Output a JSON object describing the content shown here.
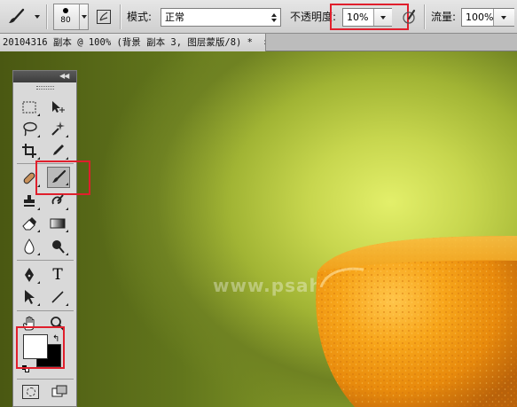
{
  "options_bar": {
    "brush_size": "80",
    "mode_label": "模式:",
    "mode_value": "正常",
    "opacity_label": "不透明度:",
    "opacity_value": "10%",
    "flow_label": "流量:",
    "flow_value": "100%"
  },
  "document": {
    "tab_title": "20104316 副本 @ 100% (背景 副本 3, 图层蒙版/8) *",
    "close_glyph": "×"
  },
  "toolbox": {
    "type_tool_glyph": "T",
    "active_tool": "brush",
    "foreground_color": "#ffffff",
    "background_color": "#000000"
  },
  "canvas": {
    "watermark": "www.psahz.com"
  },
  "highlight_color": "#e01f2c"
}
